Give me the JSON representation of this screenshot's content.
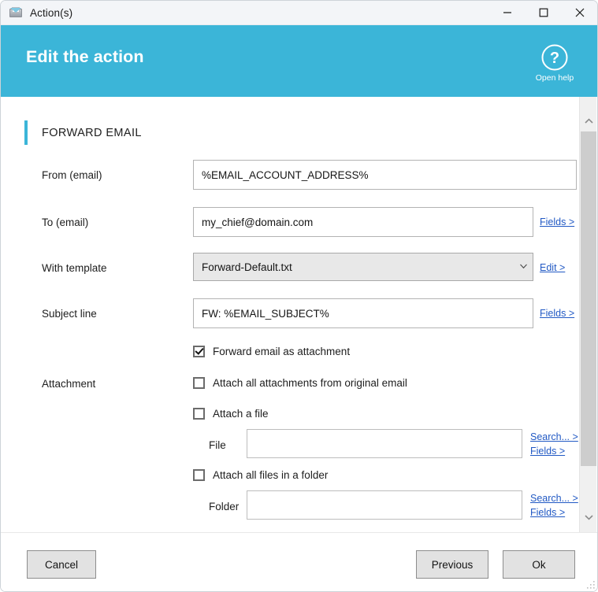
{
  "window": {
    "title": "Action(s)",
    "icon": "mail-image-icon",
    "controls": {
      "minimize": "minimize-icon",
      "maximize": "maximize-icon",
      "close": "close-icon"
    }
  },
  "header": {
    "title": "Edit the action",
    "help_label": "Open help",
    "help_icon": "question-mark-circle-icon",
    "background_color": "#3bb5d8"
  },
  "section": {
    "title": "FORWARD EMAIL",
    "accent_color": "#3bb5d8"
  },
  "fields": {
    "from": {
      "label": "From (email)",
      "value": "%EMAIL_ACCOUNT_ADDRESS%",
      "placeholder": ""
    },
    "to": {
      "label": "To (email)",
      "value": "my_chief@domain.com",
      "placeholder": "",
      "link": "Fields >"
    },
    "template": {
      "label": "With template",
      "value": "Forward-Default.txt",
      "options": [
        "Forward-Default.txt"
      ],
      "link": "Edit >"
    },
    "subject": {
      "label": "Subject line",
      "value": "FW: %EMAIL_SUBJECT%",
      "placeholder": "",
      "link": "Fields >"
    },
    "attachment": {
      "label": "Attachment"
    },
    "file": {
      "label": "File",
      "value": "",
      "placeholder": "",
      "search_link": "Search... >",
      "fields_link": "Fields >"
    },
    "folder": {
      "label": "Folder",
      "value": "",
      "placeholder": "",
      "search_link": "Search... >",
      "fields_link": "Fields >"
    }
  },
  "checkboxes": {
    "forward_as_attachment": {
      "label": "Forward email as attachment",
      "checked": true
    },
    "attach_all_from_original": {
      "label": "Attach all attachments from original email",
      "checked": false
    },
    "attach_a_file": {
      "label": "Attach a file",
      "checked": false
    },
    "attach_all_in_folder": {
      "label": "Attach all files in a folder",
      "checked": false
    }
  },
  "footer": {
    "cancel": "Cancel",
    "previous": "Previous",
    "ok": "Ok"
  },
  "scrollbar": {
    "up_icon": "chevron-up-icon",
    "down_icon": "chevron-down-icon"
  }
}
